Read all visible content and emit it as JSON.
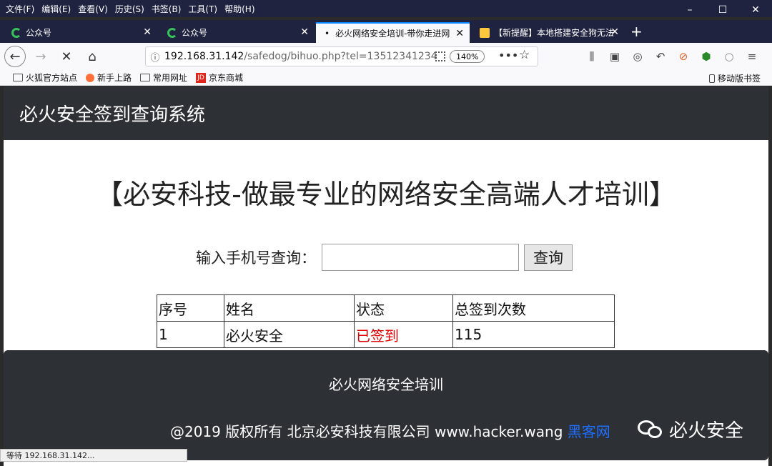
{
  "menubar": {
    "items": [
      "文件(F)",
      "编辑(E)",
      "查看(V)",
      "历史(S)",
      "书签(B)",
      "工具(T)",
      "帮助(H)"
    ]
  },
  "window_controls": {
    "minimize": "–",
    "maximize": "☐",
    "close": "✕"
  },
  "tabs": [
    {
      "label": "公众号"
    },
    {
      "label": "公众号"
    },
    {
      "label": "必火网络安全培训-带你走进网"
    },
    {
      "label": "【新提醒】本地搭建安全狗无法"
    }
  ],
  "navbar": {
    "url_host": "192.168.31.142",
    "url_path": "/safedog/bihuo.php?tel=13512341234",
    "zoom": "140%"
  },
  "bookmarks": {
    "items": [
      "火狐官方站点",
      "新手上路",
      "常用网址",
      "京东商城"
    ],
    "mobile": "移动版书签"
  },
  "page": {
    "header_title": "必火安全签到查询系统",
    "banner": "【必安科技-做最专业的网络安全高端人才培训】",
    "search_label": "输入手机号查询：",
    "search_value": "",
    "search_button": "查询",
    "table": {
      "headers": [
        "序号",
        "姓名",
        "状态",
        "总签到次数"
      ],
      "rows": [
        {
          "no": "1",
          "name": "必火安全",
          "status": "已签到",
          "count": "115"
        }
      ]
    },
    "footer_title": "必火网络安全培训",
    "footer_copy": "@2019 版权所有 北京必安科技有限公司 www.hacker.wang",
    "footer_link": "黑客网",
    "watermark": "必火安全"
  },
  "statusbar": {
    "text": "等待 192.168.31.142..."
  },
  "colors": {
    "status_signed": "#e00000",
    "accent": "#0a84ff",
    "link": "#1e6fff"
  }
}
